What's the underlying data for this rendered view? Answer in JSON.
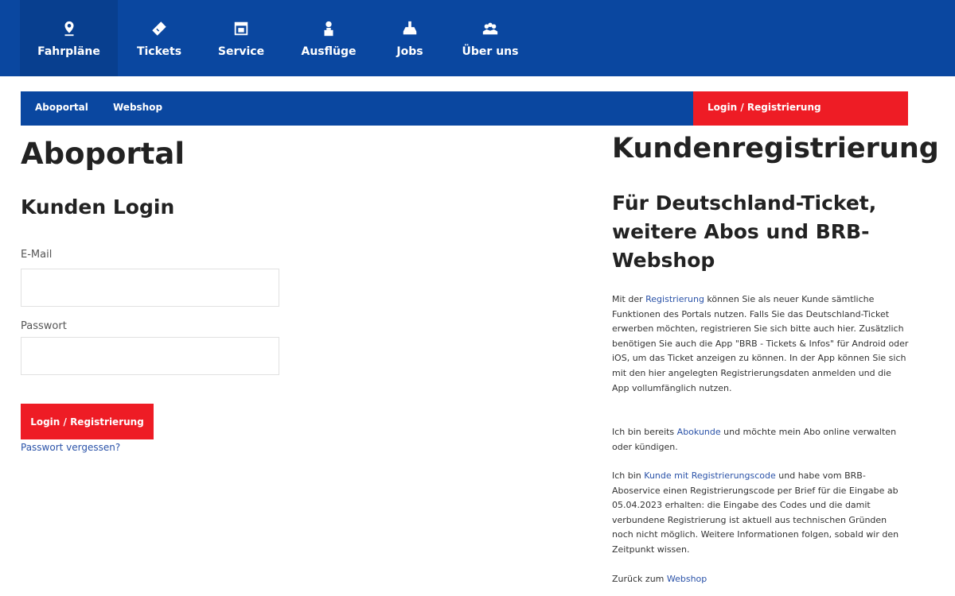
{
  "topnav": {
    "items": [
      {
        "label": "Fahrpläne",
        "icon": "map-pin-icon"
      },
      {
        "label": "Tickets",
        "icon": "ticket-icon"
      },
      {
        "label": "Service",
        "icon": "service-icon"
      },
      {
        "label": "Ausflüge",
        "icon": "person-icon"
      },
      {
        "label": "Jobs",
        "icon": "jobs-icon"
      },
      {
        "label": "Über uns",
        "icon": "group-icon"
      }
    ],
    "active": "Fahrpläne"
  },
  "subnav": {
    "aboportal": "Aboportal",
    "webshop": "Webshop",
    "login": "Login / Registrierung"
  },
  "login": {
    "title": "Aboportal",
    "subtitle": "Kunden Login",
    "email_label": "E-Mail",
    "email_value": "",
    "password_label": "Passwort",
    "password_value": "",
    "button": "Login / Registrierung",
    "forgot": "Passwort vergessen?"
  },
  "register": {
    "title": "Kundenregistrierung",
    "subtitle": "Für Deutschland-Ticket, weitere Abos und BRB-Webshop",
    "p1_before": "Mit der ",
    "p1_link": "Registrierung",
    "p1_after": " können Sie als neuer Kunde sämtliche Funktionen des Portals nutzen. Falls Sie das Deutschland-Ticket erwerben möchten, registrieren Sie sich bitte auch hier. Zusätzlich benötigen Sie auch die App \"BRB - Tickets & Infos\" für Android oder iOS, um das Ticket anzeigen zu können. In der App können Sie sich mit den hier angelegten Registrierungsdaten anmelden und die App vollumfänglich nutzen.",
    "p2_before": "Ich bin bereits ",
    "p2_link": "Abokunde",
    "p2_after": " und möchte mein Abo online verwalten oder kündigen.",
    "p3_before": "Ich bin ",
    "p3_link": "Kunde mit Registrierungscode",
    "p3_after": " und habe vom BRB-Aboservice einen Registrierungscode per Brief für die Eingabe ab 05.04.2023 erhalten: die Eingabe des Codes und die damit verbundene Registrierung ist aktuell aus technischen Gründen noch nicht möglich. Weitere Informationen folgen, sobald wir den Zeitpunkt wissen.",
    "p4_before": "Zurück zum ",
    "p4_link": "Webshop"
  },
  "colors": {
    "brand_blue": "#0a47a0",
    "accent_red": "#ee1c25",
    "link_blue": "#2a52a8"
  }
}
